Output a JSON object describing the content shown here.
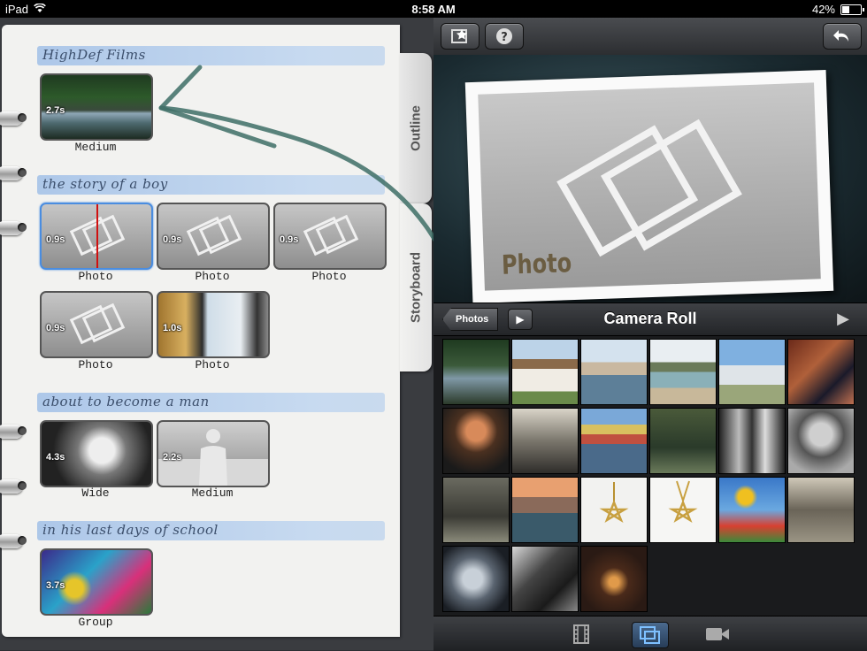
{
  "status": {
    "device": "iPad",
    "time": "8:58 AM",
    "battery": "42%"
  },
  "storyboard": {
    "tabs": {
      "outline": "Outline",
      "storyboard": "Storyboard"
    },
    "scenes": [
      {
        "title": "HighDef Films",
        "shots": [
          {
            "duration": "2.7s",
            "label": "Medium"
          }
        ]
      },
      {
        "title": "the story of a boy",
        "shots": [
          {
            "duration": "0.9s",
            "label": "Photo"
          },
          {
            "duration": "0.9s",
            "label": "Photo"
          },
          {
            "duration": "0.9s",
            "label": "Photo"
          },
          {
            "duration": "0.9s",
            "label": "Photo"
          },
          {
            "duration": "1.0s",
            "label": "Photo"
          }
        ]
      },
      {
        "title": "about to become a man",
        "shots": [
          {
            "duration": "4.3s",
            "label": "Wide"
          },
          {
            "duration": "2.2s",
            "label": "Medium"
          }
        ]
      },
      {
        "title": "in his last days of school",
        "shots": [
          {
            "duration": "3.7s",
            "label": "Group"
          }
        ]
      }
    ]
  },
  "preview": {
    "label": "Photo"
  },
  "browser": {
    "back_label": "Photos",
    "title": "Camera Roll"
  },
  "colors": {
    "accent_selected": "#4a8de0",
    "playhead": "#d01010"
  },
  "icons": {
    "toolbar": [
      "clip-star-icon",
      "help-icon",
      "undo-icon"
    ],
    "bottom": [
      "film-strip-icon",
      "photos-icon",
      "video-camera-icon"
    ]
  }
}
